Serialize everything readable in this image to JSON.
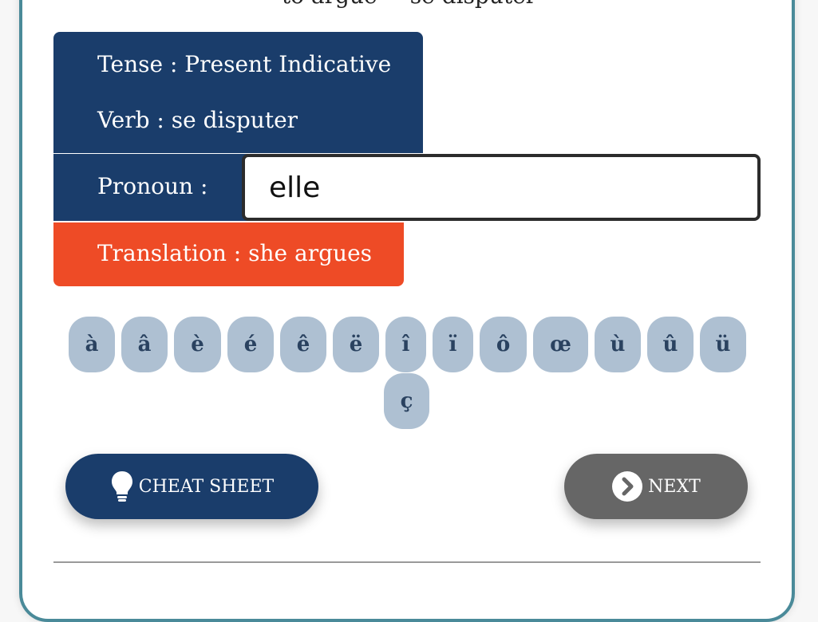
{
  "header": {
    "top_text": "to argue = se disputer"
  },
  "info": {
    "tense_label": "Tense :",
    "tense_value": "Present Indicative",
    "verb_label": "Verb :",
    "verb_value": "se disputer"
  },
  "pronoun": {
    "label": "Pronoun :",
    "value": "elle"
  },
  "translation": {
    "label": "Translation :",
    "value": "she argues"
  },
  "accents": [
    "à",
    "â",
    "è",
    "é",
    "ê",
    "ë",
    "î",
    "ï",
    "ô",
    "œ",
    "ù",
    "û",
    "ü",
    "ç"
  ],
  "buttons": {
    "cheat_sheet_label": "CHEAT SHEET",
    "cheat_sheet_icon": "lightbulb-icon",
    "next_label": "NEXT",
    "next_icon": "chevron-right-circle-icon"
  },
  "colors": {
    "primary": "#1a3d6b",
    "accent": "#ee4b26",
    "accent_key": "#aec0d2",
    "next_button": "#666666"
  }
}
